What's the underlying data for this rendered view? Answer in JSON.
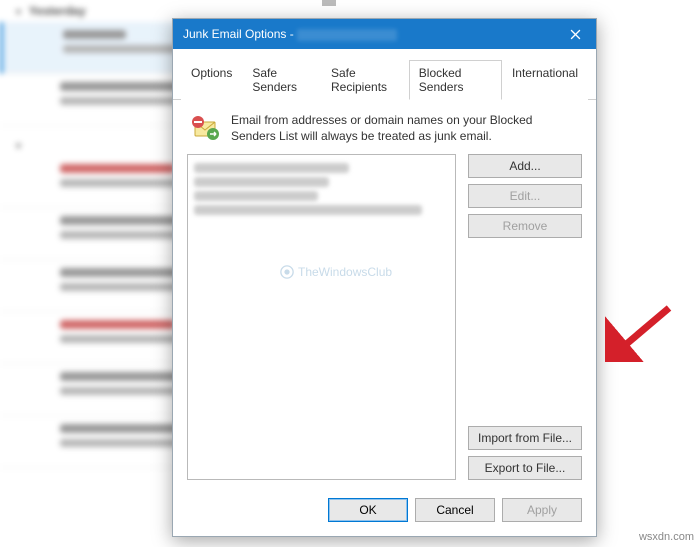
{
  "background": {
    "section": "Yesterday"
  },
  "dialog": {
    "title": "Junk Email Options - ",
    "tabs": {
      "options": "Options",
      "safe_senders": "Safe Senders",
      "safe_recipients": "Safe Recipients",
      "blocked_senders": "Blocked Senders",
      "international": "International"
    },
    "description": "Email from addresses or domain names on your Blocked Senders List will always be treated as junk email.",
    "buttons": {
      "add": "Add...",
      "edit": "Edit...",
      "remove": "Remove",
      "import": "Import from File...",
      "export": "Export to File..."
    },
    "footer": {
      "ok": "OK",
      "cancel": "Cancel",
      "apply": "Apply"
    }
  },
  "watermark": "TheWindowsClub",
  "source": "wsxdn.com"
}
